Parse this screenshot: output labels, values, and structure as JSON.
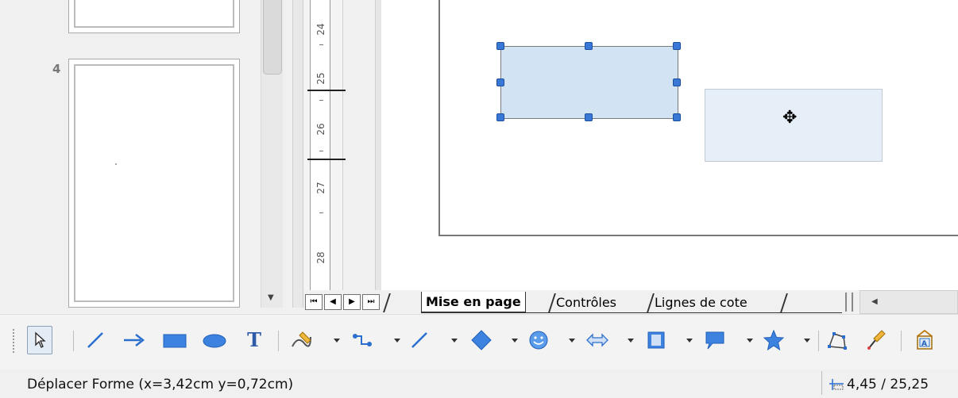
{
  "slides": {
    "current_number": "4"
  },
  "ruler": {
    "labels": [
      "24",
      "25",
      "26",
      "27",
      "28"
    ]
  },
  "tabs": {
    "active": "Mise en page",
    "others": [
      "Contrôles",
      "Lignes de cote"
    ]
  },
  "toolbar": {
    "tools": [
      "select-icon",
      "line-icon",
      "arrow-icon",
      "rectangle-icon",
      "ellipse-icon",
      "text-icon",
      "curve-icon",
      "connector-icon",
      "lines-arrows-icon",
      "basic-shapes-icon",
      "symbol-shapes-icon",
      "block-arrows-icon",
      "flowchart-icon",
      "callouts-icon",
      "stars-icon",
      "points-icon",
      "glue-points-icon",
      "fontwork-icon"
    ],
    "text_tool_glyph": "T"
  },
  "statusbar": {
    "action": "Déplacer Forme (x=3,42cm y=0,72cm)",
    "size": "4,45 / 25,25"
  },
  "colors": {
    "selected_fill": "#d2e4f4",
    "ghost_fill": "#e6eef7",
    "handle": "#3a78d8",
    "icon_blue": "#2b6fce"
  }
}
